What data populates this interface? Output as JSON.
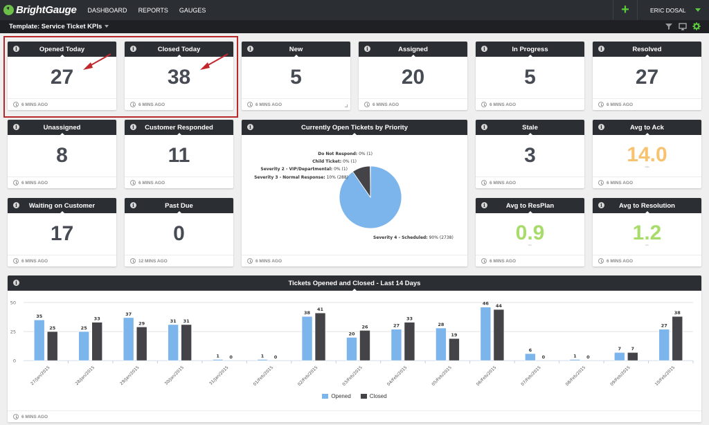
{
  "app": {
    "logo_text": "BrightGauge",
    "nav": [
      "DASHBOARD",
      "REPORTS",
      "GAUGES"
    ],
    "user_name": "ERIC DOSAL",
    "add_icon": "plus-icon",
    "template_title": "Template: Service Ticket KPIs",
    "toolbar_icons": [
      "filter-icon",
      "tv-icon",
      "gear-icon"
    ],
    "colors": {
      "accent": "#5ccb3c",
      "header": "#2b2e33",
      "opened": "#7cb5ec",
      "closed": "#434348",
      "orange": "#f7c370",
      "green": "#a8dc6a",
      "highlight": "#b7282b"
    }
  },
  "gauges": [
    {
      "title": "Opened Today",
      "value": "27",
      "updated": "6 MINS AGO",
      "color": "#474b54"
    },
    {
      "title": "Closed Today",
      "value": "38",
      "updated": "6 MINS AGO",
      "color": "#474b54"
    },
    {
      "title": "New",
      "value": "5",
      "updated": "6 MINS AGO",
      "color": "#474b54"
    },
    {
      "title": "Assigned",
      "value": "20",
      "updated": "6 MINS AGO",
      "color": "#474b54"
    },
    {
      "title": "In Progress",
      "value": "5",
      "updated": "6 MINS AGO",
      "color": "#474b54"
    },
    {
      "title": "Resolved",
      "value": "27",
      "updated": "6 MINS AGO",
      "color": "#474b54"
    },
    {
      "title": "Unassigned",
      "value": "8",
      "updated": "6 MINS AGO",
      "color": "#474b54"
    },
    {
      "title": "Customer Responded",
      "value": "11",
      "updated": "6 MINS AGO",
      "color": "#474b54"
    },
    {
      "title": "Stale",
      "value": "3",
      "updated": "6 MINS AGO",
      "color": "#474b54"
    },
    {
      "title": "Avg to Ack",
      "value": "14.0",
      "unit": "mins",
      "updated": "6 MINS AGO",
      "color": "#f7c370"
    },
    {
      "title": "Waiting on Customer",
      "value": "17",
      "updated": "6 MINS AGO",
      "color": "#474b54"
    },
    {
      "title": "Past Due",
      "value": "0",
      "updated": "12 MINS AGO",
      "color": "#474b54"
    },
    {
      "title": "Avg to ResPlan",
      "value": "0.9",
      "unit": "hrs",
      "updated": "6 MINS AGO",
      "color": "#a8dc6a"
    },
    {
      "title": "Avg to Resolution",
      "value": "1.2",
      "unit": "hrs",
      "updated": "6 MINS AGO",
      "color": "#a8dc6a"
    }
  ],
  "pie_card": {
    "title": "Currently Open Tickets by Priority",
    "updated": "6 MINS AGO"
  },
  "bar_card": {
    "title": "Tickets Opened and Closed - Last 14 Days",
    "updated": "6 MINS AGO"
  },
  "chart_data": [
    {
      "type": "pie",
      "title": "Currently Open Tickets by Priority",
      "slices": [
        {
          "label": "Severity 4 - Scheduled",
          "percent": "90%",
          "count": 2738,
          "color": "#7cb5ec"
        },
        {
          "label": "Severity 3 - Normal Response",
          "percent": "10%",
          "count": 288,
          "color": "#434348"
        },
        {
          "label": "Severity 2 - VIP/Departmental",
          "percent": "0%",
          "count": 1,
          "color": "#90ed7d"
        },
        {
          "label": "Child Ticket",
          "percent": "0%",
          "count": 1,
          "color": "#f7a35c"
        },
        {
          "label": "Do Not Respond",
          "percent": "0%",
          "count": 1,
          "color": "#8085e9"
        }
      ]
    },
    {
      "type": "bar",
      "title": "Tickets Opened and Closed - Last 14 Days",
      "categories": [
        "27/Jan/2015",
        "28/Jan/2015",
        "29/Jan/2015",
        "30/Jan/2015",
        "31/Jan/2015",
        "01/Feb/2015",
        "02/Feb/2015",
        "03/Feb/2015",
        "04/Feb/2015",
        "05/Feb/2015",
        "06/Feb/2015",
        "07/Feb/2015",
        "08/Feb/2015",
        "09/Feb/2015",
        "10/Feb/2015"
      ],
      "series": [
        {
          "name": "Opened",
          "color": "#7cb5ec",
          "values": [
            35,
            25,
            37,
            31,
            1,
            1,
            38,
            20,
            27,
            28,
            46,
            6,
            1,
            7,
            27
          ]
        },
        {
          "name": "Closed",
          "color": "#434348",
          "values": [
            25,
            33,
            29,
            31,
            0,
            0,
            41,
            26,
            33,
            19,
            44,
            0,
            0,
            7,
            38
          ]
        }
      ],
      "ylim": [
        0,
        50
      ],
      "yticks": [
        0,
        25,
        50
      ],
      "grid": true,
      "legend": "bottom-center"
    }
  ]
}
